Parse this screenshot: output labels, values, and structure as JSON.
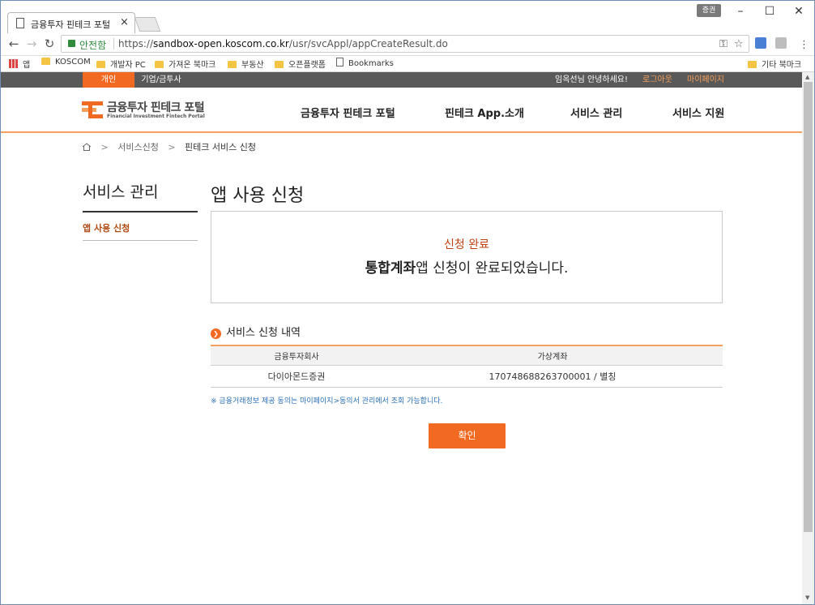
{
  "browser": {
    "tab_title": "금융투자 핀테크 포털",
    "tab_close": "×",
    "profile_label": "증권",
    "win_minimize": "–",
    "win_maximize": "☐",
    "win_close": "✕",
    "secure_label": "안전함",
    "url_scheme": "https://",
    "url_host": "sandbox-open.koscom.co.kr",
    "url_path": "/usr/svcAppl/appCreateResult.do",
    "bookmarks": [
      "앱",
      "KOSCOM",
      "개발자 PC",
      "가져온 북마크",
      "부동산",
      "오픈플랫폼",
      "Bookmarks"
    ],
    "other_bookmarks": "기타 북마크"
  },
  "site": {
    "top_tabs": [
      "개인",
      "기업/금투사"
    ],
    "greeting": "임옥선님 안녕하세요!",
    "logout": "로그아웃",
    "mypage": "마이페이지",
    "logo_title": "금융투자 핀테크 포털",
    "logo_sub": "Financial Investment Fintech Portal",
    "nav": [
      "금융투자 핀테크 포털",
      "핀테크 App.소개",
      "서비스 관리",
      "서비스 지원"
    ],
    "breadcrumb": [
      "서비스신청",
      "핀테크 서비스 신청"
    ],
    "brand_color": "#f26a21"
  },
  "lnb": {
    "title": "서비스 관리",
    "items": [
      "앱 사용 신청"
    ]
  },
  "main": {
    "page_title": "앱 사용 신청",
    "status": "신청 완료",
    "message_bold": "통합계좌",
    "message_rest": "앱 신청이 완료되었습니다.",
    "section_title": "서비스 신청 내역",
    "table": {
      "headers": [
        "금융투자회사",
        "가상계좌"
      ],
      "rows": [
        [
          "다이아몬드증권",
          "170748688263700001 / 별칭"
        ]
      ]
    },
    "note": "※ 금융거래정보 제공 동의는 마이페이지>동의서 관리에서 조회 가능합니다.",
    "confirm": "확인"
  }
}
